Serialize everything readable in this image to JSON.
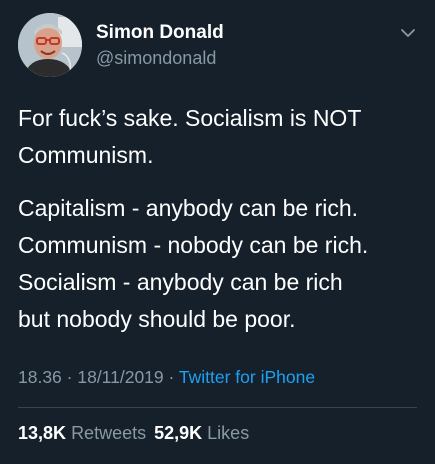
{
  "tweet": {
    "author": {
      "name": "Simon Donald",
      "handle": "@simondonald"
    },
    "paragraph1": [
      "For fuck’s sake. Socialism is NOT",
      "Communism."
    ],
    "paragraph2": [
      "Capitalism - anybody can be rich.",
      "Communism - nobody can be rich.",
      "Socialism - anybody can be rich",
      "but nobody should be poor."
    ],
    "meta": {
      "time": "18.36",
      "separator1": " · ",
      "date": "18/11/2019",
      "separator2": " · ",
      "source": "Twitter for iPhone"
    },
    "stats": {
      "retweets_count": "13,8K",
      "retweets_label": "Retweets",
      "likes_count": "52,9K",
      "likes_label": "Likes"
    },
    "icons": {
      "menu": "chevron-down-icon"
    }
  },
  "colors": {
    "background": "#15202b",
    "primary_text": "#ffffff",
    "secondary_text": "#8899a6",
    "link": "#1da1f2",
    "divider": "#38444d"
  }
}
